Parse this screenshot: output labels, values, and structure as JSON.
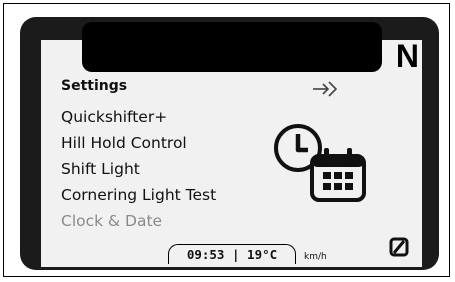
{
  "gear_indicator": "N",
  "menu": {
    "title": "Settings",
    "items": [
      {
        "label": "Quickshifter+",
        "state": "active"
      },
      {
        "label": "Hill Hold Control",
        "state": "active"
      },
      {
        "label": "Shift Light",
        "state": "active"
      },
      {
        "label": "Cornering Light Test",
        "state": "active"
      },
      {
        "label": "Clock & Date",
        "state": "highlighted"
      }
    ]
  },
  "icons": {
    "exit": "exit-arrow-icon",
    "clock_calendar": "clock-calendar-icon",
    "status": "abs-off-icon"
  },
  "status_bar": {
    "time": "09:53",
    "temperature": "19°C",
    "speed_unit": "km/h"
  },
  "colors": {
    "bezel": "#1b1b1b",
    "screen": "#f1f1f1",
    "text": "#111111",
    "dim_text": "#8a8a8a"
  }
}
